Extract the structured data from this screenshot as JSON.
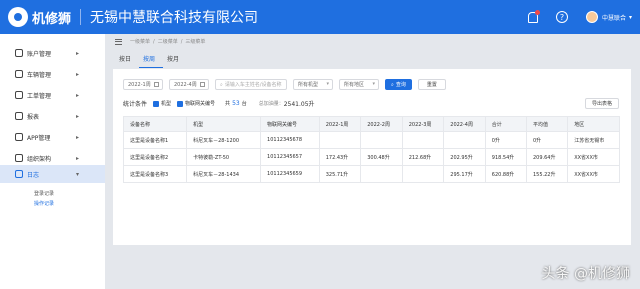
{
  "header": {
    "logo_text": "机修狮",
    "company": "无锡中慧联合科技有限公司",
    "user": "中慧联合"
  },
  "sidebar": {
    "items": [
      {
        "label": "账户管理",
        "icon": "user-icon"
      },
      {
        "label": "车辆管理",
        "icon": "car-icon"
      },
      {
        "label": "工单管理",
        "icon": "workorder-icon"
      },
      {
        "label": "报表",
        "icon": "report-icon"
      },
      {
        "label": "APP管理",
        "icon": "app-icon"
      },
      {
        "label": "组织架构",
        "icon": "org-icon"
      },
      {
        "label": "日志",
        "icon": "log-icon"
      }
    ],
    "sub_items": [
      {
        "label": "登录记录"
      },
      {
        "label": "操作记录"
      }
    ]
  },
  "breadcrumb": [
    "一级菜单",
    "二级菜单",
    "三级菜单"
  ],
  "tabs": [
    {
      "label": "按日"
    },
    {
      "label": "按周"
    },
    {
      "label": "按月"
    }
  ],
  "filters": {
    "date_start": "2022-1周",
    "date_end": "2022-4周",
    "search_placeholder": "请输入车主姓名/设备名称",
    "model": "所有机型",
    "region": "所有地区",
    "query": "查询",
    "reset": "重置"
  },
  "summary": {
    "label": "统计条件",
    "cb1": "机型",
    "cb2": "物联网关编号",
    "total_prefix": "共",
    "total": "53",
    "total_suffix": "台",
    "fuel_label": "总加油量：",
    "fuel_value": "2541.05升",
    "export": "导出表格"
  },
  "table": {
    "headers": [
      "设备名称",
      "机型",
      "物联网关编号",
      "2022-1周",
      "2022-2周",
      "2022-3周",
      "2022-4周",
      "合计",
      "平均值",
      "地区"
    ],
    "rows": [
      [
        "这里是设备名称1",
        "科尼叉车－28-1200",
        "10112345678",
        "",
        "",
        "",
        "",
        "0升",
        "0升",
        "江苏省无锡市"
      ],
      [
        "这里是设备名称2",
        "卡特彼勒-ZT-50",
        "10112345657",
        "172.43升",
        "300.48升",
        "212.68升",
        "202.95升",
        "918.54升",
        "209.64升",
        "XX省XX市"
      ],
      [
        "这里是设备名称3",
        "科尼叉车－28-1434",
        "10112345659",
        "325.71升",
        "",
        "",
        "295.17升",
        "620.88升",
        "155.22升",
        "XX省XX市"
      ]
    ]
  },
  "watermark": "头条 @机修狮"
}
